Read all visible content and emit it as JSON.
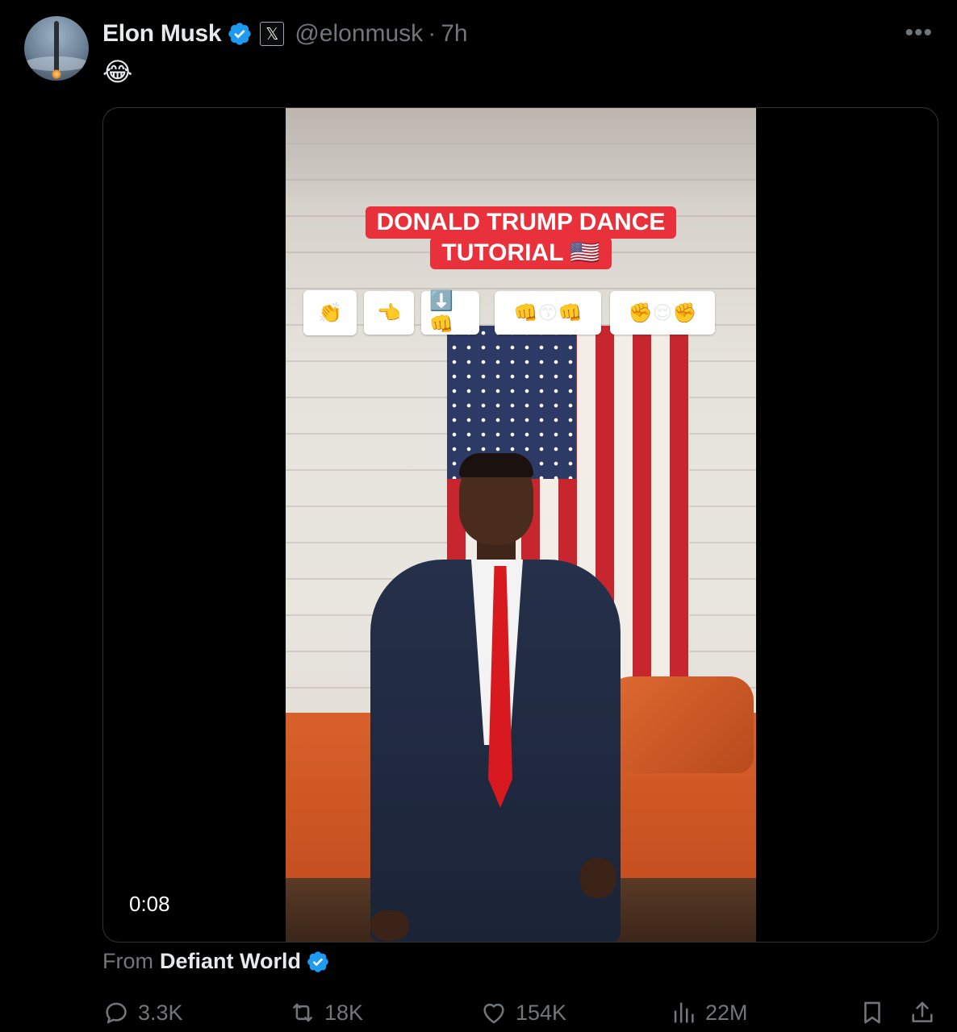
{
  "post": {
    "author_name": "Elon Musk",
    "author_handle": "@elonmusk",
    "separator": "·",
    "time": "7h",
    "x_badge": "𝕏",
    "more": "•••",
    "text": "😂"
  },
  "media": {
    "overlay_title_line1": "DONALD TRUMP DANCE",
    "overlay_title_line2": "TUTORIAL 🇺🇸",
    "chips": [
      "👏",
      "👈",
      "⬇️👊",
      "👊😙👊",
      "✊😌✊"
    ],
    "duration": "0:08"
  },
  "source": {
    "label": "From",
    "name": "Defiant World"
  },
  "actions": {
    "replies": "3.3K",
    "reposts": "18K",
    "likes": "154K",
    "views": "22M"
  },
  "colors": {
    "background": "#000000",
    "verified": "#1d9bf0",
    "muted": "#71767b",
    "text": "#e7e9ea"
  }
}
